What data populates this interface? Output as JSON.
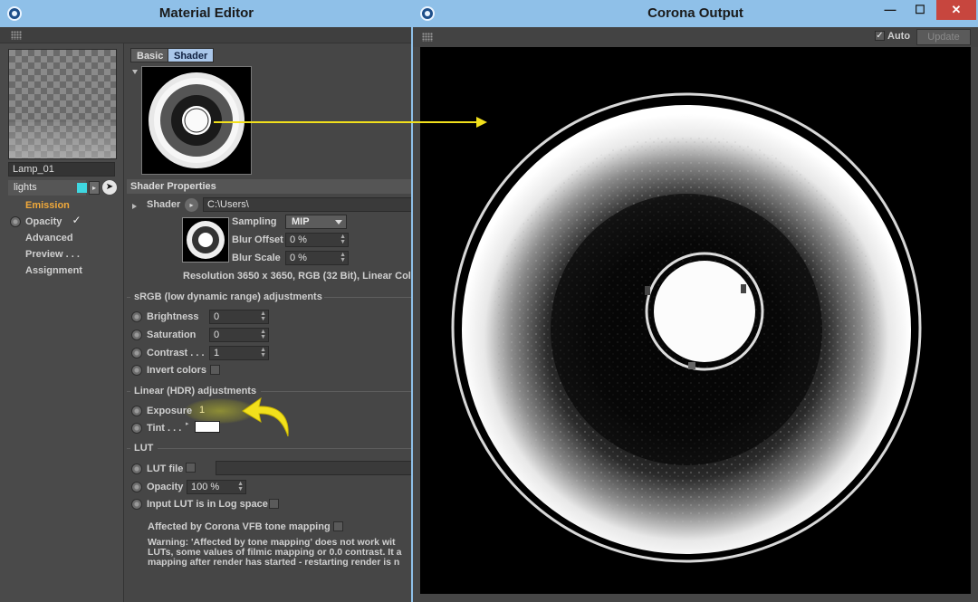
{
  "material_editor": {
    "title": "Material Editor",
    "material_name": "Lamp_01",
    "layer": "lights",
    "channels": [
      {
        "label": "Emission",
        "active": true,
        "has_radio": false
      },
      {
        "label": "Opacity",
        "active": false,
        "has_radio": true,
        "checked": true
      },
      {
        "label": "Advanced",
        "active": false,
        "has_radio": false
      },
      {
        "label": "Preview . . .",
        "active": false,
        "has_radio": false
      },
      {
        "label": "Assignment",
        "active": false,
        "has_radio": false
      }
    ],
    "tabs": [
      "Basic",
      "Shader"
    ],
    "active_tab": "Shader",
    "shader_properties": {
      "header": "Shader Properties",
      "shader_label": "Shader",
      "shader_path": "C:\\Users\\",
      "sampling_label": "Sampling",
      "sampling_value": "MIP",
      "blur_offset_label": "Blur Offset",
      "blur_offset_value": "0 %",
      "blur_scale_label": "Blur Scale",
      "blur_scale_value": "0 %",
      "resolution_text": "Resolution 3650 x 3650, RGB (32 Bit), Linear Colo"
    },
    "srgb": {
      "header": "sRGB (low dynamic range) adjustments",
      "brightness_label": "Brightness",
      "brightness_value": "0",
      "saturation_label": "Saturation",
      "saturation_value": "0",
      "contrast_label": "Contrast . . .",
      "contrast_value": "1",
      "invert_label": "Invert colors"
    },
    "linear": {
      "header": "Linear (HDR) adjustments",
      "exposure_label": "Exposure",
      "exposure_value": "1",
      "tint_label": "Tint . . .",
      "tint_color": "#ffffff"
    },
    "lut": {
      "header": "LUT",
      "file_label": "LUT file",
      "opacity_label": "Opacity",
      "opacity_value": "100 %",
      "log_label": "Input LUT is in Log space"
    },
    "affected_label": "Affected by Corona VFB tone mapping",
    "warning_lines": [
      "Warning: 'Affected by tone mapping' does not work wit",
      "LUTs, some values of filmic mapping or 0.0 contrast. It a",
      "mapping after render has started - restarting render is n"
    ]
  },
  "corona_output": {
    "title": "Corona Output",
    "auto_label": "Auto",
    "auto_checked": true,
    "update_label": "Update",
    "minimize_glyph": "—",
    "maximize_glyph": "☐",
    "close_glyph": "✕"
  },
  "colors": {
    "title_bar": "#8fc0e8",
    "active_channel": "#f1a93a",
    "annotation_arrow": "#f2e01c",
    "close_button": "#c7463e"
  }
}
